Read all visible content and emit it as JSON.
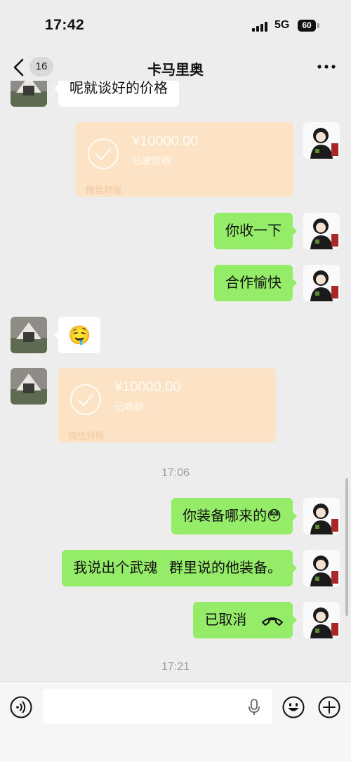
{
  "status_bar": {
    "time": "17:42",
    "network": "5G",
    "battery": "60"
  },
  "header": {
    "back_count": "16",
    "title": "卡马里奥"
  },
  "messages": {
    "top_partial": "呢就谈好的价格",
    "transfer_sent": {
      "amount": "¥10000.00",
      "status": "已被接收",
      "label": "微信转账"
    },
    "msg_1": "你收一下",
    "msg_2": "合作愉快",
    "emoji_reply": "🤤",
    "transfer_received": {
      "amount": "¥10000.00",
      "status": "已收款",
      "label": "微信转账"
    },
    "time_1": "17:06",
    "msg_3": "你装备哪来的😳",
    "msg_4": "我说出个武魂   群里说的他装备。",
    "call_cancelled": "已取消",
    "time_2": "17:21"
  },
  "input_bar": {
    "voice_icon": "voice-toggle-icon",
    "mic_icon": "microphone-icon",
    "emoji_icon": "emoji-icon",
    "plus_icon": "plus-icon"
  },
  "colors": {
    "self_bubble": "#95ec69",
    "other_bubble": "#ffffff",
    "transfer": "#fde3c6",
    "background": "#ededed"
  }
}
